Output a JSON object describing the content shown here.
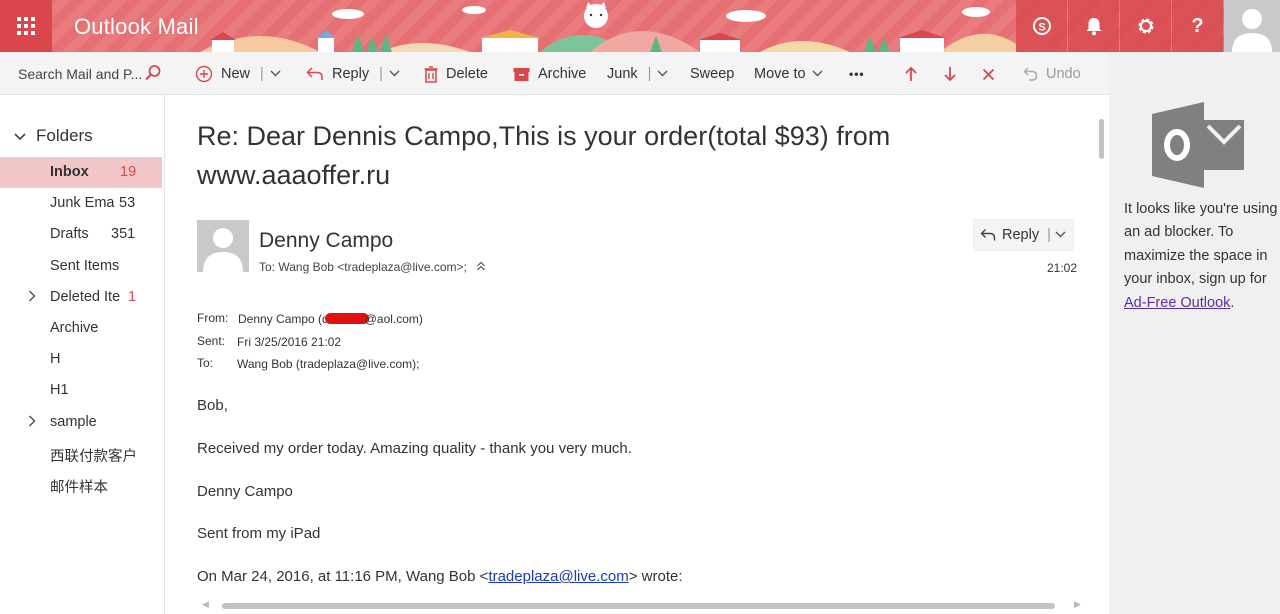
{
  "header": {
    "app_title": "Outlook Mail",
    "buttons": [
      {
        "name": "skype-icon"
      },
      {
        "name": "bell-icon"
      },
      {
        "name": "gear-icon"
      },
      {
        "name": "help-icon",
        "glyph": "?"
      }
    ]
  },
  "search": {
    "placeholder": "Search Mail and P..."
  },
  "folders": {
    "heading": "Folders",
    "items": [
      {
        "label": "Inbox",
        "count": "19",
        "selected": true
      },
      {
        "label": "Junk Ema",
        "count": "53"
      },
      {
        "label": "Drafts",
        "count": "351"
      },
      {
        "label": "Sent Items",
        "count": ""
      },
      {
        "label": "Deleted Ite",
        "count": "1",
        "expandable": true
      },
      {
        "label": "Archive",
        "count": ""
      },
      {
        "label": "H",
        "count": ""
      },
      {
        "label": "H1",
        "count": ""
      },
      {
        "label": "sample",
        "count": "",
        "expandable": true
      },
      {
        "label": "西联付款客户",
        "count": ""
      },
      {
        "label": "邮件样本",
        "count": ""
      }
    ]
  },
  "toolbar": {
    "new_label": "New",
    "reply_label": "Reply",
    "delete_label": "Delete",
    "archive_label": "Archive",
    "junk_label": "Junk",
    "sweep_label": "Sweep",
    "moveto_label": "Move to",
    "more_label": "•••",
    "undo_label": "Undo"
  },
  "message": {
    "subject": "Re: Dear Dennis Campo,This is your order(total $93) from www.aaaoffer.ru",
    "sender_name": "Denny Campo",
    "to_line": "To: Wang Bob <tradeplaza@live.com>;",
    "reply_label": "Reply",
    "time": "21:02",
    "fields": {
      "from_label": "From:",
      "from_prefix": "Denny Campo (d",
      "from_suffix": "@aol.com)",
      "sent_label": "Sent:",
      "sent_value": "Fri 3/25/2016 21:02",
      "to_label": "To:",
      "to_value": "Wang Bob (tradeplaza@live.com);"
    },
    "body": {
      "greeting": "Bob,",
      "line1": "Received my order today. Amazing quality - thank you very much.",
      "signature": "Denny Campo",
      "sent_from": "Sent from my iPad",
      "quote_prefix": "On Mar 24, 2016, at 11:16 PM, Wang Bob <",
      "quote_email": "tradeplaza@live.com",
      "quote_suffix": "> wrote:"
    }
  },
  "ad": {
    "text": "It looks like you're using an ad blocker. To maximize the space in your inbox, sign up for ",
    "link": "Ad-Free Outlook",
    "suffix": "."
  },
  "colors": {
    "accent": "#d9474c",
    "header": "#e8777a",
    "selected_folder": "#f2c7c9",
    "link": "#1a3bbf"
  }
}
